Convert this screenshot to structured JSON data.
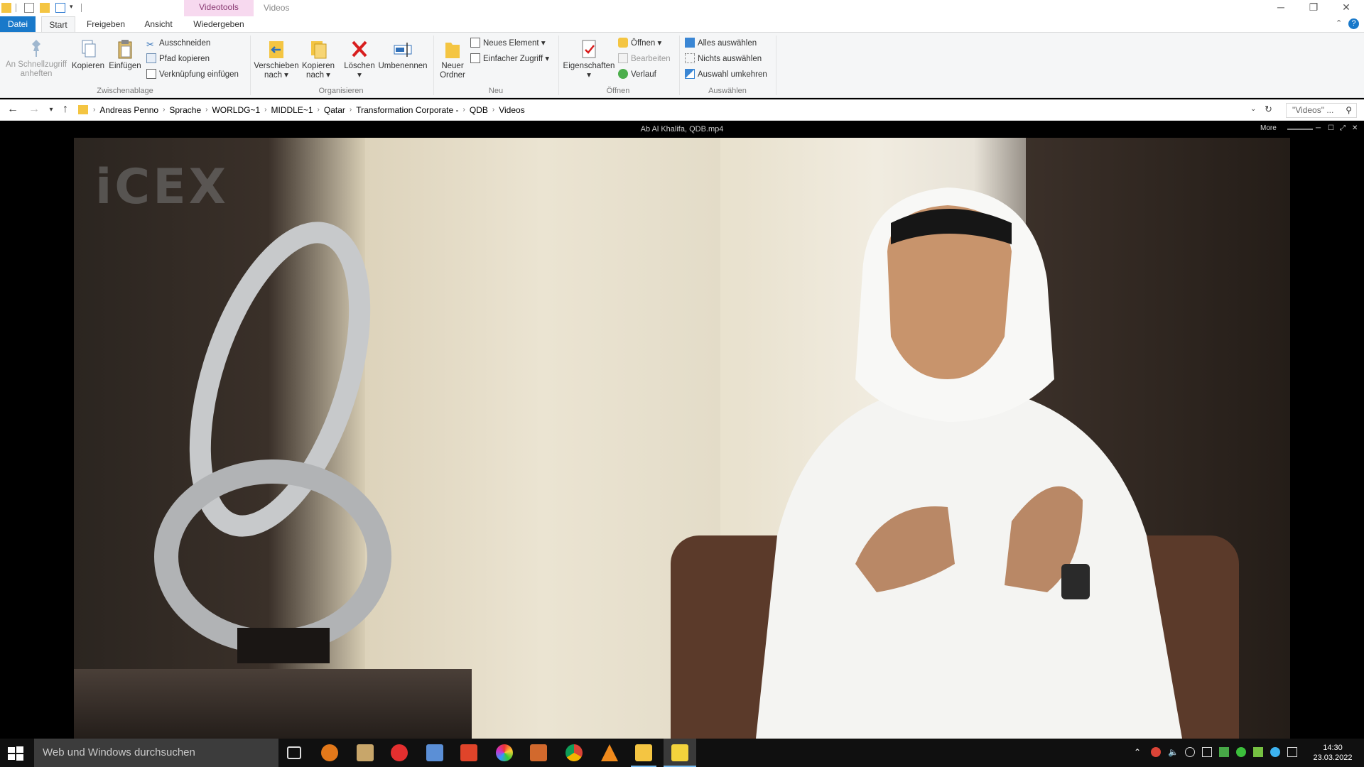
{
  "window": {
    "contextual_tab": "Videotools",
    "title": "Videos"
  },
  "tabs": [
    {
      "label": "Datei"
    },
    {
      "label": "Start"
    },
    {
      "label": "Freigeben"
    },
    {
      "label": "Ansicht"
    },
    {
      "label": "Wiedergeben"
    }
  ],
  "ribbon": {
    "clipboard": {
      "pin_label": "An Schnellzugriff anheften",
      "copy_label": "Kopieren",
      "paste_label": "Einfügen",
      "cut_label": "Ausschneiden",
      "copy_path_label": "Pfad kopieren",
      "paste_shortcut_label": "Verknüpfung einfügen",
      "group_label": "Zwischenablage"
    },
    "organize": {
      "move_label": "Verschieben nach",
      "copy_to_label": "Kopieren nach",
      "delete_label": "Löschen",
      "rename_label": "Umbenennen",
      "group_label": "Organisieren"
    },
    "new": {
      "new_folder_label": "Neuer Ordner",
      "new_item_label": "Neues Element",
      "easy_access_label": "Einfacher Zugriff",
      "group_label": "Neu"
    },
    "open": {
      "properties_label": "Eigenschaften",
      "open_label": "Öffnen",
      "edit_label": "Bearbeiten",
      "history_label": "Verlauf",
      "group_label": "Öffnen"
    },
    "select": {
      "select_all_label": "Alles auswählen",
      "select_none_label": "Nichts auswählen",
      "invert_label": "Auswahl umkehren",
      "group_label": "Auswählen"
    }
  },
  "breadcrumb": [
    "Andreas Penno",
    "Sprache",
    "WORLDG~1",
    "MIDDLE~1",
    "Qatar",
    "Transformation Corporate -",
    "QDB",
    "Videos"
  ],
  "search": {
    "placeholder": "\"Videos\" ..."
  },
  "player": {
    "title": "Ab Al Khalifa, QDB.mp4",
    "more_label": "More",
    "watermark": "iCEX"
  },
  "taskbar": {
    "search_placeholder": "Web und Windows durchsuchen",
    "time": "14:30",
    "date": "23.03.2022"
  },
  "colors": {
    "accent": "#1979ca",
    "ribbon_bg": "#f5f6f7",
    "context_tab": "#f7d9ef",
    "taskbar": "#101010"
  }
}
